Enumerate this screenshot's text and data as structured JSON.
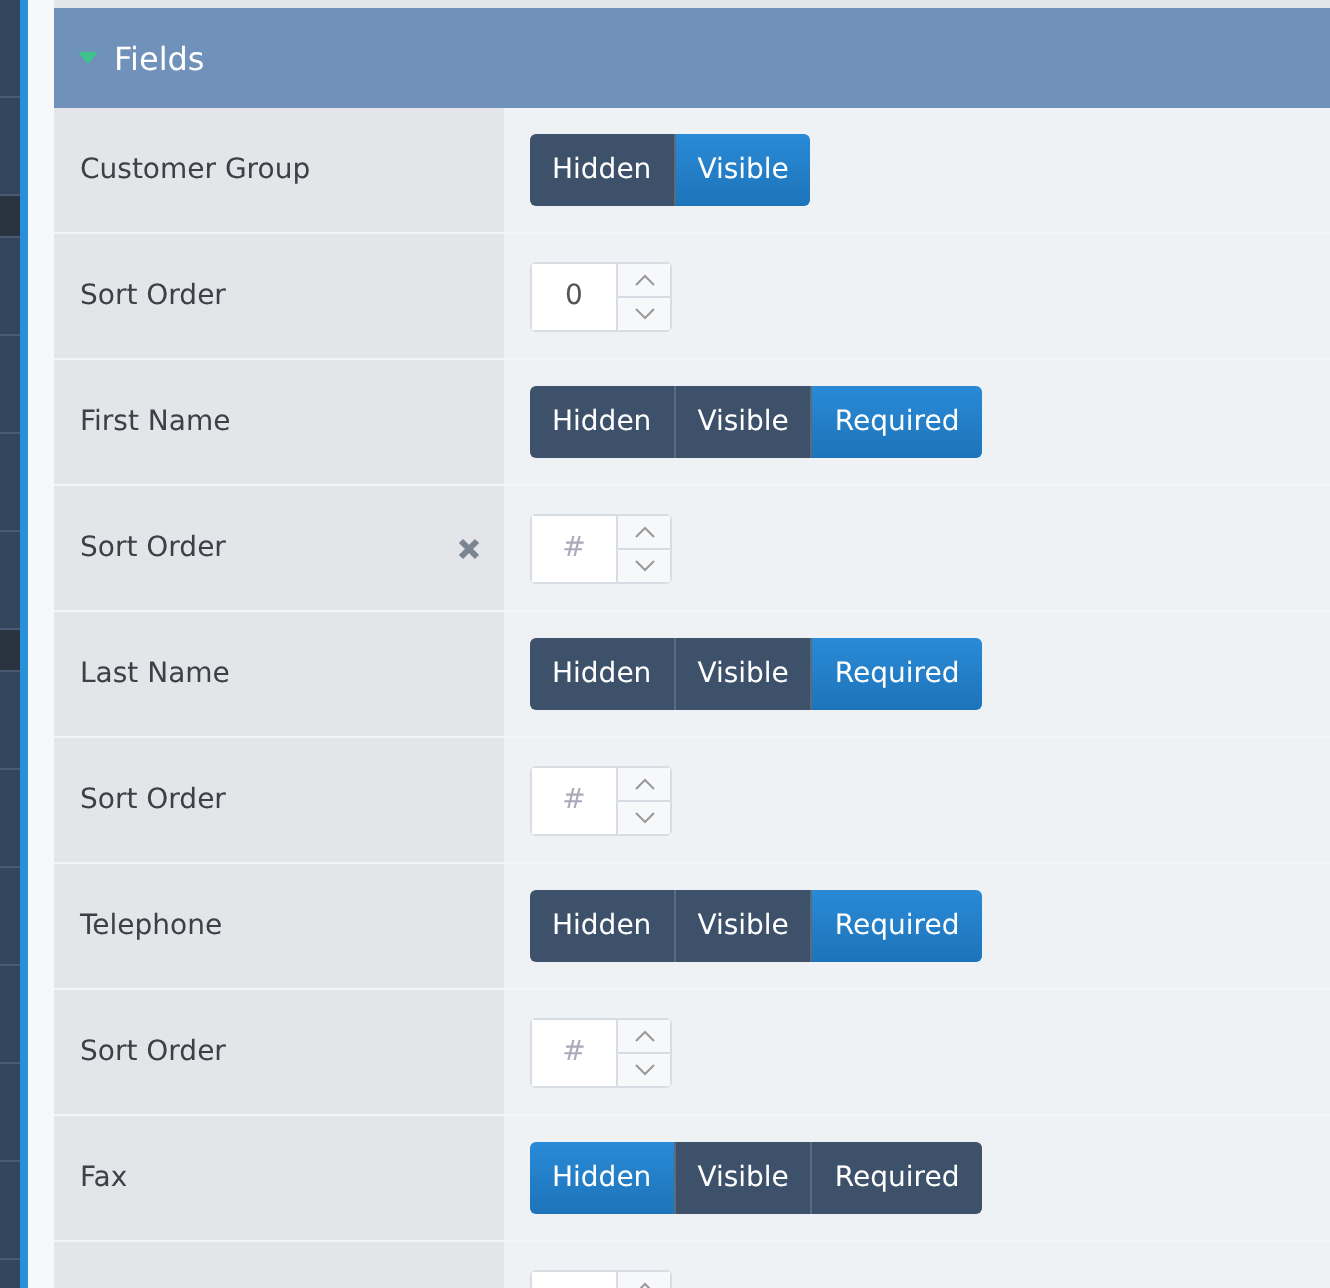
{
  "panel": {
    "title": "Fields",
    "expanded": true
  },
  "rows": [
    {
      "kind": "toggle",
      "label": "Customer Group",
      "options": [
        {
          "label": "Hidden",
          "selected": false
        },
        {
          "label": "Visible",
          "selected": true
        }
      ]
    },
    {
      "kind": "spinner",
      "label": "Sort Order",
      "value": "0",
      "clearable": false
    },
    {
      "kind": "toggle",
      "label": "First Name",
      "options": [
        {
          "label": "Hidden",
          "selected": false
        },
        {
          "label": "Visible",
          "selected": false
        },
        {
          "label": "Required",
          "selected": true
        }
      ]
    },
    {
      "kind": "spinner",
      "label": "Sort Order",
      "placeholder": "#",
      "clearable": true
    },
    {
      "kind": "toggle",
      "label": "Last Name",
      "options": [
        {
          "label": "Hidden",
          "selected": false
        },
        {
          "label": "Visible",
          "selected": false
        },
        {
          "label": "Required",
          "selected": true
        }
      ]
    },
    {
      "kind": "spinner",
      "label": "Sort Order",
      "placeholder": "#",
      "clearable": false
    },
    {
      "kind": "toggle",
      "label": "Telephone",
      "options": [
        {
          "label": "Hidden",
          "selected": false
        },
        {
          "label": "Visible",
          "selected": false
        },
        {
          "label": "Required",
          "selected": true
        }
      ]
    },
    {
      "kind": "spinner",
      "label": "Sort Order",
      "placeholder": "#",
      "clearable": false
    },
    {
      "kind": "toggle",
      "label": "Fax",
      "options": [
        {
          "label": "Hidden",
          "selected": true
        },
        {
          "label": "Visible",
          "selected": false
        },
        {
          "label": "Required",
          "selected": false
        }
      ]
    },
    {
      "kind": "spinner",
      "clearable": false
    }
  ]
}
